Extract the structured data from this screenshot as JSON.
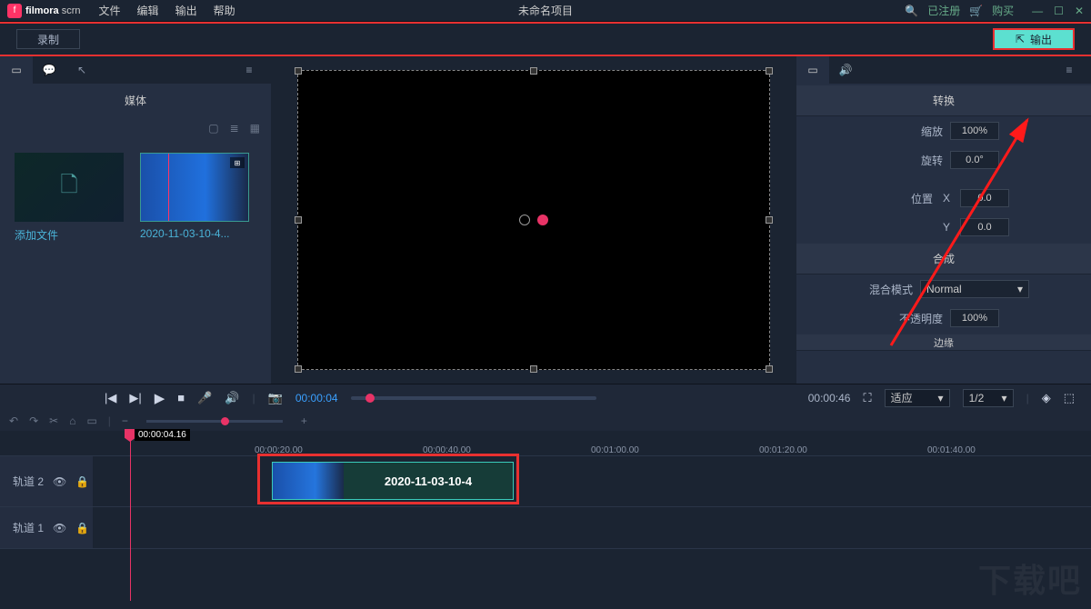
{
  "app": {
    "brand_a": "filmora",
    "brand_b": "scrn"
  },
  "menu": {
    "file": "文件",
    "edit": "编辑",
    "output": "输出",
    "help": "帮助"
  },
  "project_title": "未命名项目",
  "title_right": {
    "registered": "已注册",
    "buy": "购买"
  },
  "toolbar": {
    "record": "录制",
    "export": "输出"
  },
  "media_panel": {
    "title": "媒体",
    "items": [
      {
        "label": "添加文件",
        "kind": "add"
      },
      {
        "label": "2020-11-03-10-4...",
        "kind": "clip"
      }
    ]
  },
  "properties": {
    "transform_title": "转换",
    "scale_label": "缩放",
    "scale_value": "100%",
    "rotate_label": "旋转",
    "rotate_value": "0.0°",
    "position_label": "位置",
    "x_label": "X",
    "x_value": "0.0",
    "y_label": "Y",
    "y_value": "0.0",
    "compose_title": "合成",
    "blend_label": "混合模式",
    "blend_value": "Normal",
    "opacity_label": "不透明度",
    "opacity_value": "100%",
    "edge_title": "边缘"
  },
  "playback": {
    "current": "00:00:04",
    "total": "00:00:46",
    "fit": "适应",
    "speed": "1/2"
  },
  "timeline": {
    "playhead": "00:00:04.16",
    "ticks": [
      "00:00:20.00",
      "00:00:40.00",
      "00:01:00.00",
      "00:01:20.00",
      "00:01:40.00"
    ],
    "track2": "轨道 2",
    "track1": "轨道 1",
    "clip_label": "2020-11-03-10-4"
  },
  "watermark": "下载吧"
}
